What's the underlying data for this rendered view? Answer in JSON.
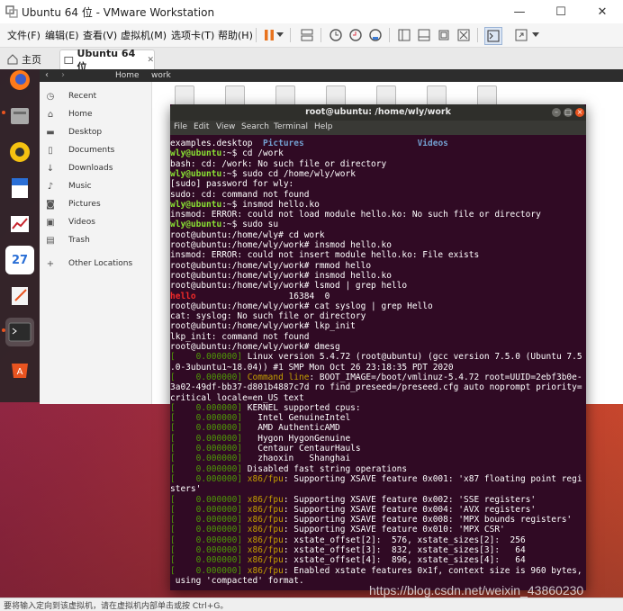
{
  "window": {
    "title": "Ubuntu 64 位 - VMware Workstation",
    "minimize": "—",
    "maximize": "☐",
    "close": "✕"
  },
  "menu": {
    "items": [
      "文件(F)",
      "编辑(E)",
      "查看(V)",
      "虚拟机(M)",
      "选项卡(T)",
      "帮助(H)"
    ]
  },
  "tabs": [
    {
      "label": "主页"
    },
    {
      "label": "Ubuntu 64 位"
    }
  ],
  "tab_close": "✕",
  "colors": {
    "accent": "#e95420",
    "terminal_bg": "#300a24",
    "prompt_user": "#8ae234",
    "prompt_path": "#729fcf",
    "error_red": "#ef2929",
    "timestamp_green": "#4e9a06",
    "highlight_yellow": "#c4a000"
  },
  "nautilus": {
    "breadcrumbs": [
      "Home",
      "work"
    ],
    "sidebar": [
      {
        "label": "Recent",
        "icon": "clock-icon"
      },
      {
        "label": "Home",
        "icon": "home-icon"
      },
      {
        "label": "Desktop",
        "icon": "folder-icon"
      },
      {
        "label": "Documents",
        "icon": "document-icon"
      },
      {
        "label": "Downloads",
        "icon": "download-icon"
      },
      {
        "label": "Music",
        "icon": "music-icon"
      },
      {
        "label": "Pictures",
        "icon": "camera-icon"
      },
      {
        "label": "Videos",
        "icon": "video-icon"
      },
      {
        "label": "Trash",
        "icon": "trash-icon"
      },
      {
        "label": "Other Locations",
        "icon": "plus-icon"
      }
    ]
  },
  "dock": {
    "apps": [
      "firefox-icon",
      "files-icon",
      "rhythmbox-icon",
      "writer-icon",
      "impress-icon",
      "calendar-icon",
      "text-editor-icon",
      "terminal-icon",
      "software-icon"
    ],
    "calendar_day": "27"
  },
  "terminal": {
    "title": "root@ubuntu: /home/wly/work",
    "menu": [
      "File",
      "Edit",
      "View",
      "Search",
      "Terminal",
      "Help"
    ],
    "lines": [
      {
        "seg": [
          [
            "w",
            "examples.desktop  "
          ],
          [
            "p",
            "Pictures"
          ],
          [
            "w",
            "                      "
          ],
          [
            "p",
            "Videos"
          ]
        ]
      },
      {
        "seg": [
          [
            "u",
            "wly@ubuntu"
          ],
          [
            "w",
            ":~$ cd /work"
          ]
        ]
      },
      {
        "seg": [
          [
            "w",
            "bash: cd: /work: No such file or directory"
          ]
        ]
      },
      {
        "seg": [
          [
            "u",
            "wly@ubuntu"
          ],
          [
            "w",
            ":~$ sudo cd /home/wly/work"
          ]
        ]
      },
      {
        "seg": [
          [
            "w",
            "[sudo] password for wly:"
          ]
        ]
      },
      {
        "seg": [
          [
            "w",
            "sudo: cd: command not found"
          ]
        ]
      },
      {
        "seg": [
          [
            "u",
            "wly@ubuntu"
          ],
          [
            "w",
            ":~$ insmod hello.ko"
          ]
        ]
      },
      {
        "seg": [
          [
            "w",
            "insmod: ERROR: could not load module hello.ko: No such file or directory"
          ]
        ]
      },
      {
        "seg": [
          [
            "u",
            "wly@ubuntu"
          ],
          [
            "w",
            ":~$ sudo su"
          ]
        ]
      },
      {
        "seg": [
          [
            "w",
            "root@ubuntu:/home/wly# cd work"
          ]
        ]
      },
      {
        "seg": [
          [
            "w",
            "root@ubuntu:/home/wly/work# insmod hello.ko"
          ]
        ]
      },
      {
        "seg": [
          [
            "w",
            "insmod: ERROR: could not insert module hello.ko: File exists"
          ]
        ]
      },
      {
        "seg": [
          [
            "w",
            "root@ubuntu:/home/wly/work# rmmod hello"
          ]
        ]
      },
      {
        "seg": [
          [
            "w",
            "root@ubuntu:/home/wly/work# insmod hello.ko"
          ]
        ]
      },
      {
        "seg": [
          [
            "w",
            "root@ubuntu:/home/wly/work# lsmod | grep hello"
          ]
        ]
      },
      {
        "seg": [
          [
            "r",
            "hello"
          ],
          [
            "w",
            "                  16384  0"
          ]
        ]
      },
      {
        "seg": [
          [
            "w",
            "root@ubuntu:/home/wly/work# cat syslog | grep Hello"
          ]
        ]
      },
      {
        "seg": [
          [
            "w",
            "cat: syslog: No such file or directory"
          ]
        ]
      },
      {
        "seg": [
          [
            "w",
            "root@ubuntu:/home/wly/work# lkp_init"
          ]
        ]
      },
      {
        "seg": [
          [
            "w",
            "lkp_init: command not found"
          ]
        ]
      },
      {
        "seg": [
          [
            "w",
            "root@ubuntu:/home/wly/work# dmesg"
          ]
        ]
      },
      {
        "seg": [
          [
            "g",
            "[    0.000000] "
          ],
          [
            "w",
            "Linux version 5.4.72 (root@ubuntu) (gcc version 7.5.0 (Ubuntu 7.5"
          ]
        ]
      },
      {
        "seg": [
          [
            "w",
            ".0-3ubuntu1~18.04)) #1 SMP Mon Oct 26 23:18:35 PDT 2020"
          ]
        ]
      },
      {
        "seg": [
          [
            "g",
            "[    0.000000] "
          ],
          [
            "y",
            "Command line"
          ],
          [
            "w",
            ": BOOT_IMAGE=/boot/vmlinuz-5.4.72 root=UUID=2ebf3b0e-"
          ]
        ]
      },
      {
        "seg": [
          [
            "w",
            "3a02-49df-bb37-d801b4887c7d ro find_preseed=/preseed.cfg auto noprompt priority="
          ]
        ]
      },
      {
        "seg": [
          [
            "w",
            "critical locale=en_US text"
          ]
        ]
      },
      {
        "seg": [
          [
            "g",
            "[    0.000000] "
          ],
          [
            "w",
            "KERNEL supported cpus:"
          ]
        ]
      },
      {
        "seg": [
          [
            "g",
            "[    0.000000]   "
          ],
          [
            "w",
            "Intel GenuineIntel"
          ]
        ]
      },
      {
        "seg": [
          [
            "g",
            "[    0.000000]   "
          ],
          [
            "w",
            "AMD AuthenticAMD"
          ]
        ]
      },
      {
        "seg": [
          [
            "g",
            "[    0.000000]   "
          ],
          [
            "w",
            "Hygon HygonGenuine"
          ]
        ]
      },
      {
        "seg": [
          [
            "g",
            "[    0.000000]   "
          ],
          [
            "w",
            "Centaur CentaurHauls"
          ]
        ]
      },
      {
        "seg": [
          [
            "g",
            "[    0.000000]   "
          ],
          [
            "w",
            "zhaoxin   Shanghai"
          ]
        ]
      },
      {
        "seg": [
          [
            "g",
            "[    0.000000] "
          ],
          [
            "w",
            "Disabled fast string operations"
          ]
        ]
      },
      {
        "seg": [
          [
            "g",
            "[    0.000000] "
          ],
          [
            "y",
            "x86/fpu"
          ],
          [
            "w",
            ": Supporting XSAVE feature 0x001: 'x87 floating point regi"
          ]
        ]
      },
      {
        "seg": [
          [
            "w",
            "sters'"
          ]
        ]
      },
      {
        "seg": [
          [
            "g",
            "[    0.000000] "
          ],
          [
            "y",
            "x86/fpu"
          ],
          [
            "w",
            ": Supporting XSAVE feature 0x002: 'SSE registers'"
          ]
        ]
      },
      {
        "seg": [
          [
            "g",
            "[    0.000000] "
          ],
          [
            "y",
            "x86/fpu"
          ],
          [
            "w",
            ": Supporting XSAVE feature 0x004: 'AVX registers'"
          ]
        ]
      },
      {
        "seg": [
          [
            "g",
            "[    0.000000] "
          ],
          [
            "y",
            "x86/fpu"
          ],
          [
            "w",
            ": Supporting XSAVE feature 0x008: 'MPX bounds registers'"
          ]
        ]
      },
      {
        "seg": [
          [
            "g",
            "[    0.000000] "
          ],
          [
            "y",
            "x86/fpu"
          ],
          [
            "w",
            ": Supporting XSAVE feature 0x010: 'MPX CSR'"
          ]
        ]
      },
      {
        "seg": [
          [
            "g",
            "[    0.000000] "
          ],
          [
            "y",
            "x86/fpu"
          ],
          [
            "w",
            ": xstate_offset[2]:  576, xstate_sizes[2]:  256"
          ]
        ]
      },
      {
        "seg": [
          [
            "g",
            "[    0.000000] "
          ],
          [
            "y",
            "x86/fpu"
          ],
          [
            "w",
            ": xstate_offset[3]:  832, xstate_sizes[3]:   64"
          ]
        ]
      },
      {
        "seg": [
          [
            "g",
            "[    0.000000] "
          ],
          [
            "y",
            "x86/fpu"
          ],
          [
            "w",
            ": xstate_offset[4]:  896, xstate_sizes[4]:   64"
          ]
        ]
      },
      {
        "seg": [
          [
            "g",
            "[    0.000000] "
          ],
          [
            "y",
            "x86/fpu"
          ],
          [
            "w",
            ": Enabled xstate features 0x1f, context size is 960 bytes,"
          ]
        ]
      },
      {
        "seg": [
          [
            "w",
            " using 'compacted' format."
          ]
        ]
      }
    ]
  },
  "status": {
    "text": "要将输入定向到该虚拟机，请在虚拟机内部单击或按 Ctrl+G。"
  },
  "watermark": "https://blog.csdn.net/weixin_43860230"
}
